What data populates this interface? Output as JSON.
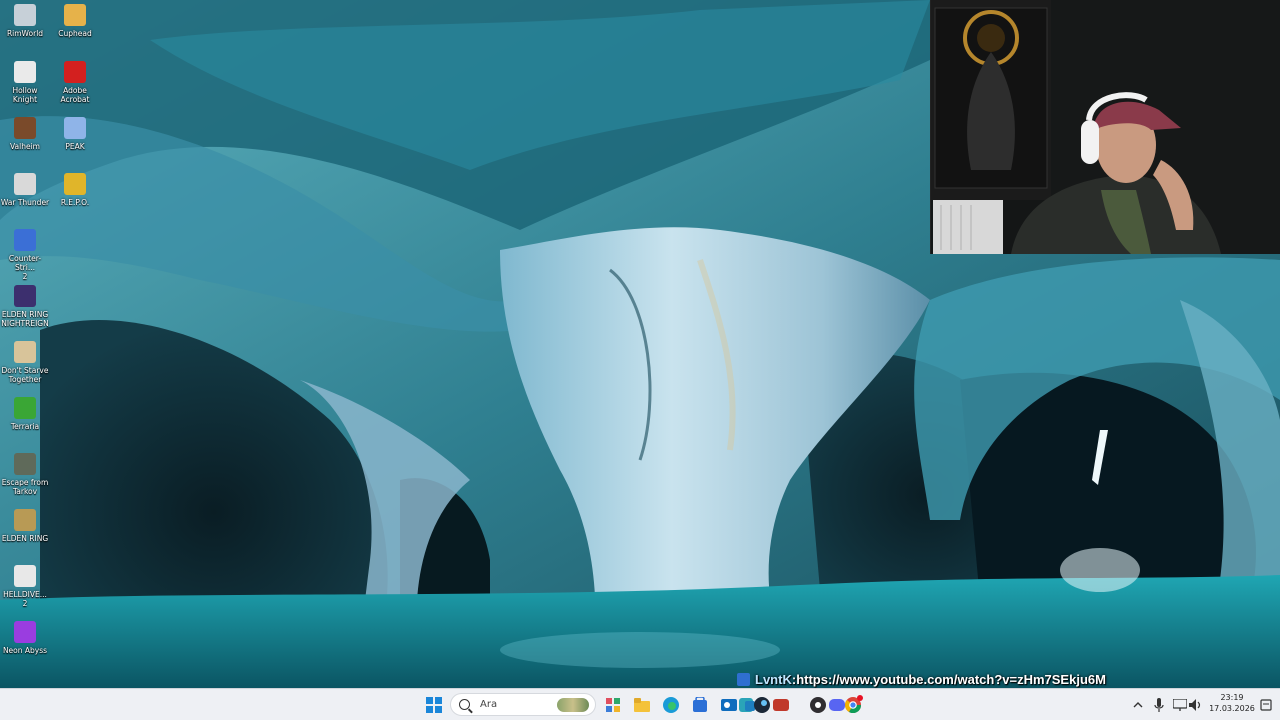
{
  "desktop": {
    "icons": [
      {
        "label": "RimWorld",
        "icon": "rimworld-icon",
        "color": "#c7d0d8"
      },
      {
        "label": "Cuphead",
        "icon": "cuphead-icon",
        "color": "#e6b24a"
      },
      {
        "label": "Hollow\nKnight",
        "icon": "hollow-knight-icon",
        "color": "#eaeaea"
      },
      {
        "label": "Adobe\nAcrobat",
        "icon": "adobe-acrobat-icon",
        "color": "#d3201f"
      },
      {
        "label": "Valheim",
        "icon": "valheim-icon",
        "color": "#7a4a2a"
      },
      {
        "label": "PEAK",
        "icon": "peak-icon",
        "color": "#8fb4e8"
      },
      {
        "label": "War Thunder",
        "icon": "war-thunder-icon",
        "color": "#d9d9d9"
      },
      {
        "label": "R.E.P.O.",
        "icon": "repo-icon",
        "color": "#e0b52a"
      },
      {
        "label": "Counter-Stri...\n2",
        "icon": "counter-strike-icon",
        "color": "#3b6fd6"
      },
      {
        "label": "ELDEN RING\nNIGHTREIGN",
        "icon": "elden-ring-nightreign-icon",
        "color": "#3c2f6e"
      },
      {
        "label": "Don't Starve\nTogether",
        "icon": "dont-starve-together-icon",
        "color": "#d8c49a"
      },
      {
        "label": "Terraria",
        "icon": "terraria-icon",
        "color": "#3aa635"
      },
      {
        "label": "Escape from\nTarkov",
        "icon": "escape-from-tarkov-icon",
        "color": "#5f6a5a"
      },
      {
        "label": "ELDEN RING",
        "icon": "elden-ring-icon",
        "color": "#b89a55"
      },
      {
        "label": "HELLDIVE...\n2",
        "icon": "helldivers-icon",
        "color": "#e8e8e8"
      },
      {
        "label": "Neon Abyss",
        "icon": "neon-abyss-icon",
        "color": "#9a3de0"
      }
    ]
  },
  "chat": {
    "user": "LvntK",
    "separator": " : ",
    "message": "https://www.youtube.com/watch?v=zHm7SEkju6M"
  },
  "taskbar": {
    "search_placeholder": "Ara",
    "apps": [
      "start-icon",
      "search-icon",
      "widgets-icon",
      "file-explorer-icon",
      "edge-icon",
      "store-icon",
      "outlook-icon",
      "teams-icon",
      "steam-icon",
      "discord-icon",
      "obs-icon",
      "chrome-icon"
    ],
    "clock_time": "23:19",
    "clock_date": "17.03.2026"
  }
}
